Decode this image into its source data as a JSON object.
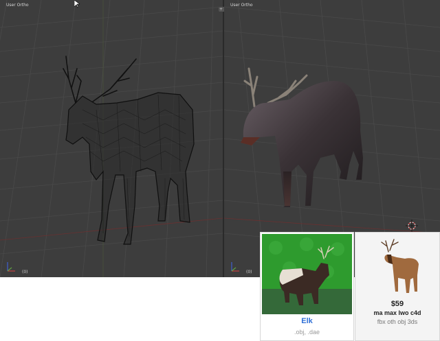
{
  "viewports": {
    "left": {
      "label": "User Ortho",
      "frame": "(0)",
      "shading": "wireframe"
    },
    "right": {
      "label": "User Ortho",
      "frame": "(0)",
      "shading": "solid"
    }
  },
  "join_handle": "+ +",
  "cards": [
    {
      "name": "Elk",
      "formats": ".obj, .dae"
    },
    {
      "price": "$59",
      "formats_primary": "ma max lwo c4d",
      "formats_secondary": "fbx oth obj 3ds"
    }
  ],
  "colors": {
    "viewport_bg": "#3d3d3d",
    "grid_line": "#4a4a4a",
    "axis_x": "#a03030",
    "axis_y": "#6a8a2a",
    "card_link": "#2f6fd6",
    "thumb_green_bg": "#2e9b2e"
  },
  "icons": [
    "mouse-cursor-icon",
    "3d-cursor-icon",
    "axis-gizmo-icon"
  ]
}
